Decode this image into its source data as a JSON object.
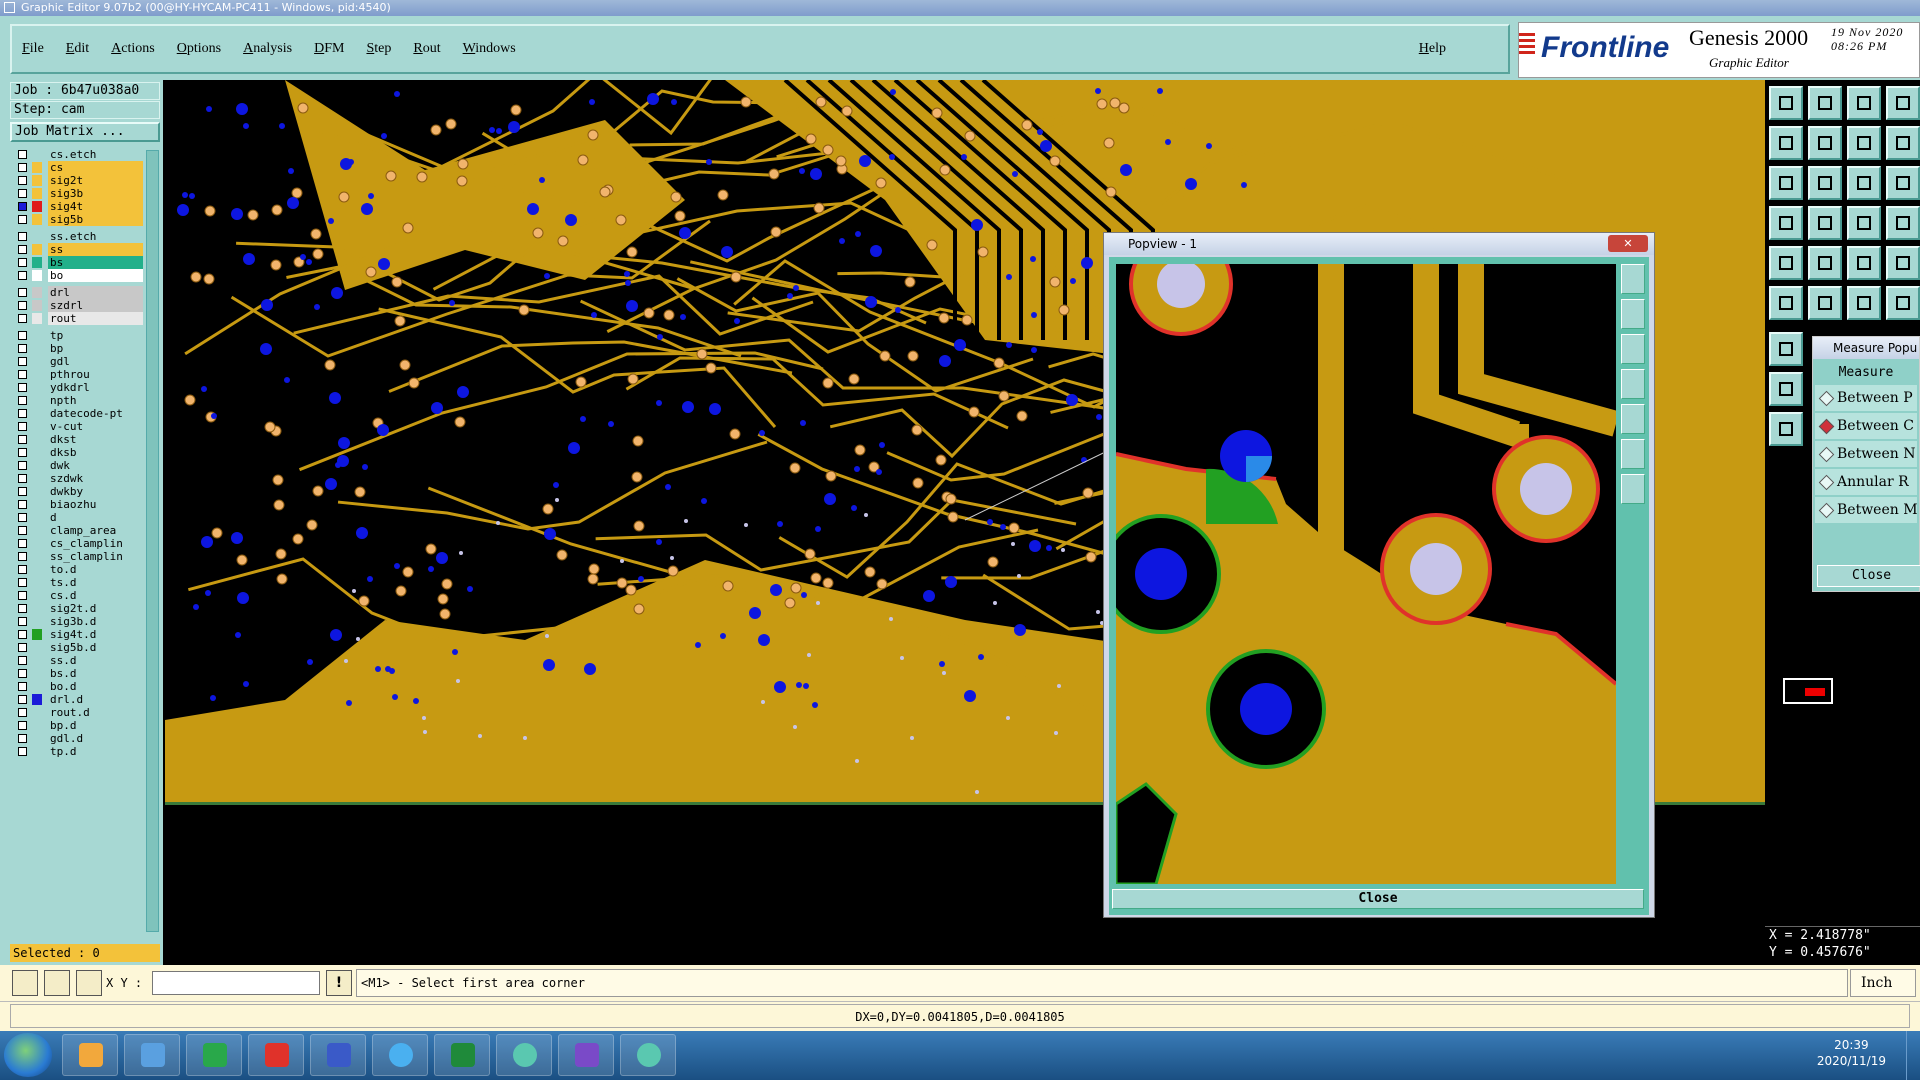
{
  "window": {
    "title": "Graphic Editor 9.07b2 (00@HY-HYCAM-PC411 - Windows, pid:4540)"
  },
  "menu": {
    "items": [
      "File",
      "Edit",
      "Actions",
      "Options",
      "Analysis",
      "DFM",
      "Step",
      "Rout",
      "Windows"
    ],
    "help": "Help"
  },
  "brand": {
    "logo": "Frontline",
    "product": "Genesis 2000",
    "subtitle": "Graphic Editor",
    "date": "19 Nov 2020",
    "time": "08:26 PM"
  },
  "job": {
    "job": "Job : 6b47u038a0",
    "step": "Step: cam",
    "matrix": "Job Matrix ..."
  },
  "layers": [
    {
      "name": "cs.etch",
      "color": "#a7d8d3",
      "bg": "#a7d8d3",
      "sep": true
    },
    {
      "name": "cs",
      "color": "#f3c23a",
      "bg": "#f3c23a"
    },
    {
      "name": "sig2t",
      "color": "#f3c23a",
      "bg": "#f3c23a"
    },
    {
      "name": "sig3b",
      "color": "#f3c23a",
      "bg": "#f3c23a"
    },
    {
      "name": "sig4t",
      "color": "#e01b1b",
      "bg": "#f3c23a",
      "cb": "#1b1bd8"
    },
    {
      "name": "sig5b",
      "color": "#f3c23a",
      "bg": "#f3c23a"
    },
    {
      "name": "ss.etch",
      "color": "#a7d8d3",
      "bg": "#a7d8d3",
      "sep": true
    },
    {
      "name": "ss",
      "color": "#f3c23a",
      "bg": "#f3c23a"
    },
    {
      "name": "bs",
      "color": "#22b08a",
      "bg": "#22b08a"
    },
    {
      "name": "bo",
      "color": "#ffffff",
      "bg": "#ffffff"
    },
    {
      "name": "drl",
      "color": "#c8c8c8",
      "bg": "#c8c8c8",
      "sep": true
    },
    {
      "name": "szdrl",
      "color": "#c8c8c8",
      "bg": "#c8c8c8"
    },
    {
      "name": "rout",
      "color": "#e8e8e8",
      "bg": "#e8e8e8"
    },
    {
      "name": "tp",
      "color": "#a7d8d3",
      "bg": "#a7d8d3",
      "sep": true
    },
    {
      "name": "bp",
      "color": "#a7d8d3",
      "bg": "#a7d8d3"
    },
    {
      "name": "gdl",
      "color": "#a7d8d3",
      "bg": "#a7d8d3"
    },
    {
      "name": "pthrou",
      "color": "#a7d8d3",
      "bg": "#a7d8d3"
    },
    {
      "name": "ydkdrl",
      "color": "#a7d8d3",
      "bg": "#a7d8d3"
    },
    {
      "name": "npth",
      "color": "#a7d8d3",
      "bg": "#a7d8d3"
    },
    {
      "name": "datecode-pt",
      "color": "#a7d8d3",
      "bg": "#a7d8d3"
    },
    {
      "name": "v-cut",
      "color": "#a7d8d3",
      "bg": "#a7d8d3"
    },
    {
      "name": "dkst",
      "color": "#a7d8d3",
      "bg": "#a7d8d3"
    },
    {
      "name": "dksb",
      "color": "#a7d8d3",
      "bg": "#a7d8d3"
    },
    {
      "name": "dwk",
      "color": "#a7d8d3",
      "bg": "#a7d8d3"
    },
    {
      "name": "szdwk",
      "color": "#a7d8d3",
      "bg": "#a7d8d3"
    },
    {
      "name": "dwkby",
      "color": "#a7d8d3",
      "bg": "#a7d8d3"
    },
    {
      "name": "biaozhu",
      "color": "#a7d8d3",
      "bg": "#a7d8d3"
    },
    {
      "name": "d",
      "color": "#a7d8d3",
      "bg": "#a7d8d3"
    },
    {
      "name": "clamp_area",
      "color": "#a7d8d3",
      "bg": "#a7d8d3"
    },
    {
      "name": "cs_clamplin",
      "color": "#a7d8d3",
      "bg": "#a7d8d3"
    },
    {
      "name": "ss_clamplin",
      "color": "#a7d8d3",
      "bg": "#a7d8d3"
    },
    {
      "name": "to.d",
      "color": "#a7d8d3",
      "bg": "#a7d8d3"
    },
    {
      "name": "ts.d",
      "color": "#a7d8d3",
      "bg": "#a7d8d3"
    },
    {
      "name": "cs.d",
      "color": "#a7d8d3",
      "bg": "#a7d8d3"
    },
    {
      "name": "sig2t.d",
      "color": "#a7d8d3",
      "bg": "#a7d8d3"
    },
    {
      "name": "sig3b.d",
      "color": "#a7d8d3",
      "bg": "#a7d8d3"
    },
    {
      "name": "sig4t.d",
      "color": "#22a022",
      "bg": "#a7d8d3"
    },
    {
      "name": "sig5b.d",
      "color": "#a7d8d3",
      "bg": "#a7d8d3"
    },
    {
      "name": "ss.d",
      "color": "#a7d8d3",
      "bg": "#a7d8d3"
    },
    {
      "name": "bs.d",
      "color": "#a7d8d3",
      "bg": "#a7d8d3"
    },
    {
      "name": "bo.d",
      "color": "#a7d8d3",
      "bg": "#a7d8d3"
    },
    {
      "name": "drl.d",
      "color": "#1b1bd8",
      "bg": "#a7d8d3"
    },
    {
      "name": "rout.d",
      "color": "#a7d8d3",
      "bg": "#a7d8d3"
    },
    {
      "name": "bp.d",
      "color": "#a7d8d3",
      "bg": "#a7d8d3"
    },
    {
      "name": "gdl.d",
      "color": "#a7d8d3",
      "bg": "#a7d8d3"
    },
    {
      "name": "tp.d",
      "color": "#a7d8d3",
      "bg": "#a7d8d3"
    }
  ],
  "selected": "Selected : 0",
  "popview": {
    "title": "Popview - 1",
    "close": "Close"
  },
  "measure": {
    "title": "Measure Popu",
    "header": "Measure",
    "options": [
      {
        "label": "Between P",
        "selected": false
      },
      {
        "label": "Between C",
        "selected": true
      },
      {
        "label": "Between N",
        "selected": false
      },
      {
        "label": "Annular R",
        "selected": false
      },
      {
        "label": "Between M",
        "selected": false
      }
    ],
    "close": "Close"
  },
  "coords": {
    "x": "X = 2.418778\"",
    "y": "Y = 0.457676\""
  },
  "command": {
    "xy_label": "X Y :",
    "xy_value": "",
    "prompt": "<M1> - Select first area corner",
    "unit": "Inch"
  },
  "status": "DX=0,DY=0.0041805,D=0.0041805",
  "taskbar": {
    "time": "20:39",
    "date": "2020/11/19"
  },
  "colors": {
    "board": "#c79a12",
    "trace": "#c79a12",
    "pad": "#f1b46c",
    "via": "#0d16e0",
    "copper_outline": "#e0322a",
    "panel": "#a7d8d3"
  }
}
